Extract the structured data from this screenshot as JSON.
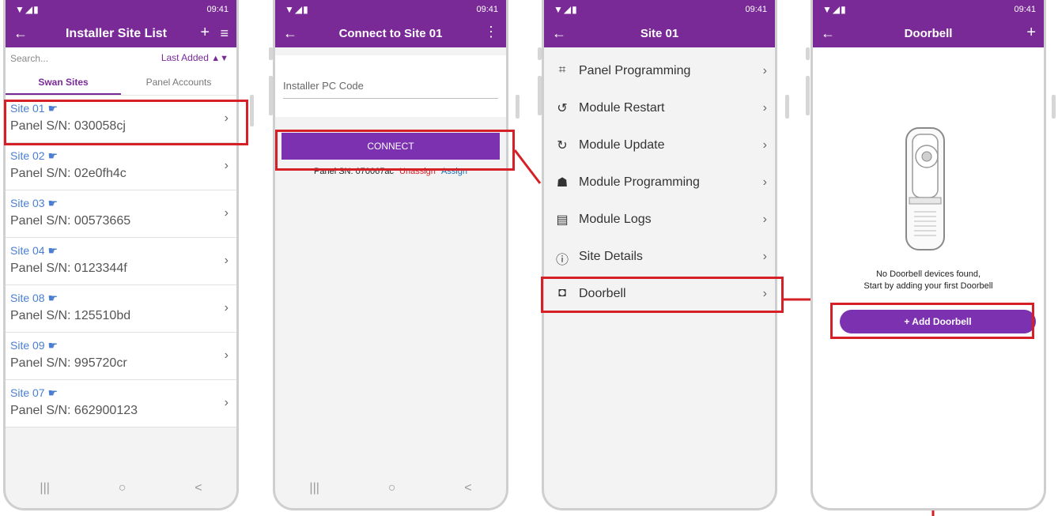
{
  "status_time": "09:41",
  "status_icons": "▼◢▮",
  "nav": {
    "recent": "|||",
    "home": "○",
    "back": "<"
  },
  "screen1": {
    "title": "Installer Site List",
    "search_placeholder": "Search...",
    "sort_label": "Last Added",
    "tabs": [
      "Swan Sites",
      "Panel Accounts"
    ],
    "sites": [
      {
        "name": "Site 01",
        "sn": "Panel S/N: 030058cj"
      },
      {
        "name": "Site 02",
        "sn": "Panel S/N: 02e0fh4c"
      },
      {
        "name": "Site 03",
        "sn": "Panel S/N: 00573665"
      },
      {
        "name": "Site 04",
        "sn": "Panel S/N: 0123344f"
      },
      {
        "name": "Site 08",
        "sn": "Panel S/N: 125510bd"
      },
      {
        "name": "Site 09",
        "sn": "Panel S/N: 995720cr"
      },
      {
        "name": "Site 07",
        "sn": "Panel S/N: 662900123"
      }
    ]
  },
  "screen2": {
    "title": "Connect to Site 01",
    "pc_code_placeholder": "Installer PC Code",
    "connect_label": "CONNECT",
    "panel_sn": "Panel SN: 070067ac",
    "unassign": "Unassign",
    "assign": "Assign"
  },
  "screen3": {
    "title": "Site 01",
    "menu": [
      {
        "label": "Panel Programming",
        "icon": "chip-icon"
      },
      {
        "label": "Module Restart",
        "icon": "restart-icon"
      },
      {
        "label": "Module Update",
        "icon": "update-icon"
      },
      {
        "label": "Module Programming",
        "icon": "network-icon"
      },
      {
        "label": "Module Logs",
        "icon": "document-icon"
      },
      {
        "label": "Site Details",
        "icon": "info-icon"
      },
      {
        "label": "Doorbell",
        "icon": "doorbell-icon"
      }
    ]
  },
  "screen4": {
    "title": "Doorbell",
    "empty_line1": "No Doorbell devices found,",
    "empty_line2": "Start by adding your first Doorbell",
    "add_label": "+ Add Doorbell"
  },
  "colors": {
    "brand": "#7a2a97",
    "highlight": "#d62027",
    "link_blue": "#4a7fd0"
  }
}
